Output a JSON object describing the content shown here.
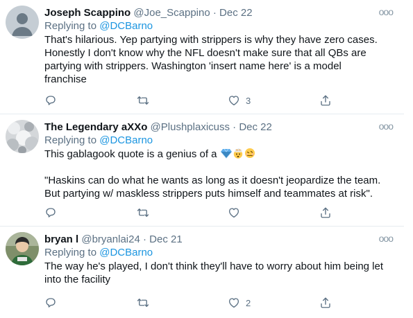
{
  "tweets": [
    {
      "name": "Joseph Scappino",
      "handle": "@Joe_Scappino",
      "date": "Dec 22",
      "reply_prefix": "Replying to ",
      "reply_to": "@DCBarno",
      "text": "That's hilarious. Yep partying with strippers is why they have zero cases.\nHonestly I don't know why the NFL doesn't make sure that all QBs are\npartying with strippers. Washington 'insert name here' is a model\nfranchise",
      "likes": "3"
    },
    {
      "name": "The Legendary aXXo",
      "handle": "@Plushplaxicuss",
      "date": "Dec 22",
      "reply_prefix": "Replying to ",
      "reply_to": "@DCBarno",
      "text_line1": "This gablagook quote is a genius of a",
      "text_body": "\"Haskins can do what he wants as long as it doesn't jeopardize the team.\nBut partying w/ maskless strippers puts himself and teammates at risk\".",
      "emojis": [
        "gem-emoji",
        "exploding-head-emoji",
        "woozy-face-emoji"
      ],
      "likes": ""
    },
    {
      "name": "bryan l",
      "handle": "@bryanlai24",
      "date": "Dec 21",
      "reply_prefix": "Replying to ",
      "reply_to": "@DCBarno",
      "text": "The way he's played, I don't think they'll have to worry about him being let\ninto the facility",
      "likes": "2"
    }
  ],
  "separator": "·",
  "more_icon": "more-icon",
  "action_icons": [
    "reply-icon",
    "retweet-icon",
    "like-icon",
    "share-icon"
  ],
  "colors": {
    "link": "#1b95e0",
    "muted": "#5b7083",
    "text": "#0f1419",
    "divider": "#e6ecf0"
  }
}
